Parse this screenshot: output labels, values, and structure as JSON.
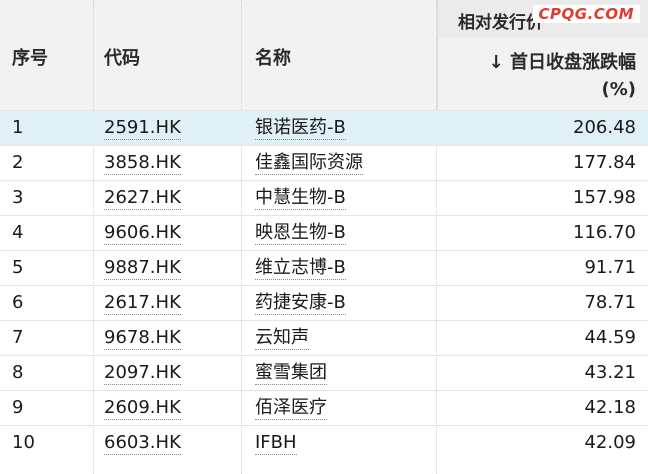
{
  "header": {
    "col_index": "序号",
    "col_code": "代码",
    "col_name": "名称",
    "group_label": "相对发行价",
    "sort_arrow": "↓",
    "sort_label": "首日收盘涨跌幅",
    "sort_unit": "(%)",
    "watermark": "CPQG.COM"
  },
  "rows": [
    {
      "idx": "1",
      "code": "2591.HK",
      "name": "银诺医药-B",
      "value": "206.48"
    },
    {
      "idx": "2",
      "code": "3858.HK",
      "name": "佳鑫国际资源",
      "value": "177.84"
    },
    {
      "idx": "3",
      "code": "2627.HK",
      "name": "中慧生物-B",
      "value": "157.98"
    },
    {
      "idx": "4",
      "code": "9606.HK",
      "name": "映恩生物-B",
      "value": "116.70"
    },
    {
      "idx": "5",
      "code": "9887.HK",
      "name": "维立志博-B",
      "value": "91.71"
    },
    {
      "idx": "6",
      "code": "2617.HK",
      "name": "药捷安康-B",
      "value": "78.71"
    },
    {
      "idx": "7",
      "code": "9678.HK",
      "name": "云知声",
      "value": "44.59"
    },
    {
      "idx": "8",
      "code": "2097.HK",
      "name": "蜜雪集团",
      "value": "43.21"
    },
    {
      "idx": "9",
      "code": "2609.HK",
      "name": "佰泽医疗",
      "value": "42.18"
    },
    {
      "idx": "10",
      "code": "6603.HK",
      "name": "IFBH",
      "value": "42.09"
    }
  ]
}
